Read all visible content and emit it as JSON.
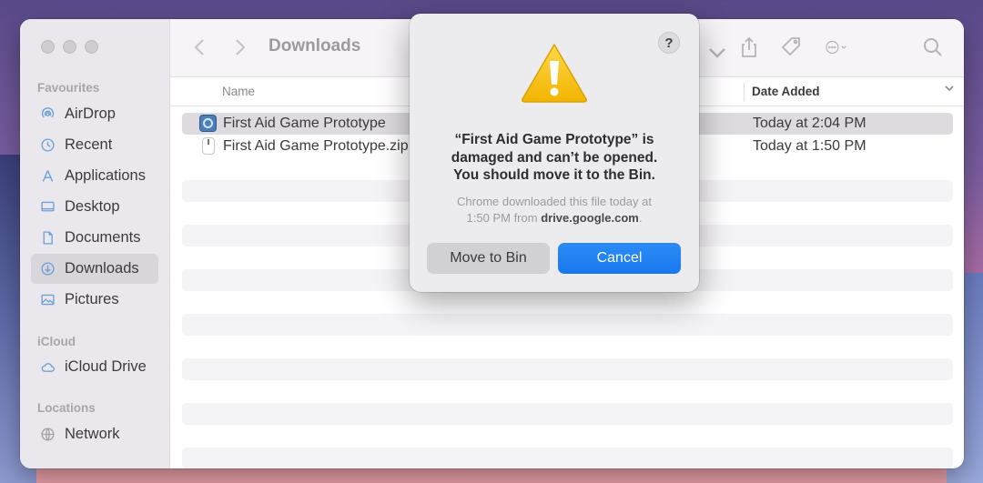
{
  "window": {
    "title": "Downloads"
  },
  "sidebar": {
    "sections": [
      {
        "label": "Favourites",
        "items": [
          {
            "label": "AirDrop",
            "icon": "airdrop-icon"
          },
          {
            "label": "Recent",
            "icon": "clock-icon"
          },
          {
            "label": "Applications",
            "icon": "applications-icon"
          },
          {
            "label": "Desktop",
            "icon": "desktop-icon"
          },
          {
            "label": "Documents",
            "icon": "document-icon"
          },
          {
            "label": "Downloads",
            "icon": "downloads-icon",
            "selected": true
          },
          {
            "label": "Pictures",
            "icon": "pictures-icon"
          }
        ]
      },
      {
        "label": "iCloud",
        "items": [
          {
            "label": "iCloud Drive",
            "icon": "cloud-icon"
          }
        ]
      },
      {
        "label": "Locations",
        "items": [
          {
            "label": "Network",
            "icon": "network-icon"
          }
        ]
      }
    ]
  },
  "toolbar": {
    "title": "Downloads",
    "back_icon": "chevron-left-icon",
    "forward_icon": "chevron-right-icon"
  },
  "columns": {
    "name": "Name",
    "date": "Date Added"
  },
  "files": [
    {
      "name": "First Aid Game Prototype",
      "date": "Today at 2:04 PM",
      "icon": "app-icon",
      "selected": true
    },
    {
      "name": "First Aid Game Prototype.zip",
      "date": "Today at 1:50 PM",
      "icon": "zip-icon"
    }
  ],
  "dialog": {
    "title_line1": "“First Aid Game Prototype” is",
    "title_line2": "damaged and can’t be opened.",
    "title_line3": "You should move it to the Bin.",
    "body_line1": "Chrome downloaded this file today at",
    "body_line2_prefix": "1:50 PM from ",
    "body_line2_domain": "drive.google.com",
    "body_line2_suffix": ".",
    "help_label": "?",
    "move_button": "Move to Bin",
    "cancel_button": "Cancel",
    "accent_color": "#1a78ef"
  }
}
